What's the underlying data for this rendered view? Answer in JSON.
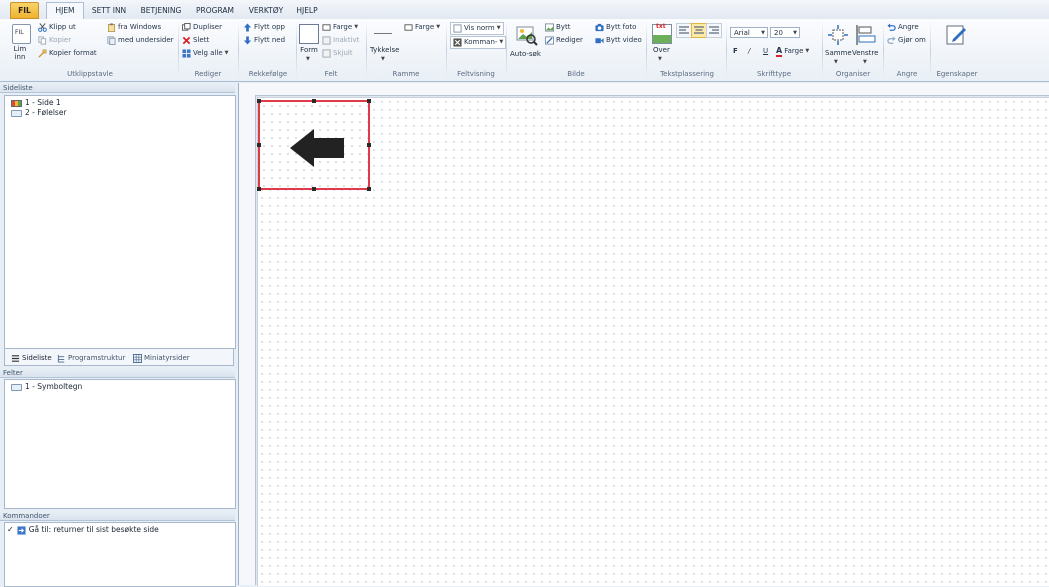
{
  "menu": {
    "file": "FIL",
    "tabs": [
      "HJEM",
      "SETT INN",
      "BETJENING",
      "PROGRAM",
      "VERKTØY",
      "HJELP"
    ]
  },
  "ribbon": {
    "clipboard": {
      "paste": "Lim inn",
      "paste_icon_text": "FIL",
      "cut": "Klipp ut",
      "copy": "Kopier",
      "copy_format": "Kopier format",
      "from_windows": "fra Windows",
      "with_subpages": "med undersider",
      "label": "Utklippstavle"
    },
    "edit": {
      "duplicate": "Dupliser",
      "delete": "Slett",
      "select_all": "Velg alle",
      "label": "Rediger"
    },
    "order": {
      "move_up": "Flytt opp",
      "move_down": "Flytt ned",
      "label": "Rekkefølge"
    },
    "field": {
      "form": "Form",
      "color": "Farge",
      "inactive": "Inaktivt",
      "hidden": "Skjult",
      "label": "Felt"
    },
    "frame": {
      "thickness": "Tykkelse",
      "color": "Farge",
      "label": "Ramme"
    },
    "field_view": {
      "view_norm": "Vis norm",
      "commands": "Komman-",
      "label": "Feltvisning"
    },
    "image": {
      "auto_search": "Auto-søk",
      "replace": "Bytt",
      "edit": "Rediger",
      "replace_photo": "Bytt foto",
      "replace_video": "Bytt video",
      "label": "Bilde"
    },
    "text_placement": {
      "over": "Over",
      "icon_text": "txt",
      "label": "Tekstplassering"
    },
    "font": {
      "family": "Arial",
      "size": "20",
      "bold": "F",
      "italic": "/",
      "underline": "U",
      "color": "Farge",
      "label": "Skrifttype"
    },
    "arrange": {
      "same": "Samme",
      "left": "Venstre",
      "label": "Organiser"
    },
    "undo": {
      "undo": "Angre",
      "redo": "Gjør om",
      "label": "Angre"
    },
    "properties": {
      "label": "Egenskaper"
    }
  },
  "panels": {
    "pages": {
      "title": "Sideliste",
      "items": [
        "1 - Side 1",
        "2 - Følelser"
      ]
    },
    "tabs": [
      "Sideliste",
      "Programstruktur",
      "Miniatyrsider"
    ],
    "fields": {
      "title": "Felter",
      "items": [
        "1 - Symboltegn"
      ]
    },
    "commands": {
      "title": "Kommandoer",
      "items": [
        "Gå til: returner til sist besøkte side"
      ],
      "check": "✓"
    }
  },
  "colors": {
    "file_tab": "#f2b838",
    "selection_border": "#e0394a",
    "arrow": "#222222"
  }
}
